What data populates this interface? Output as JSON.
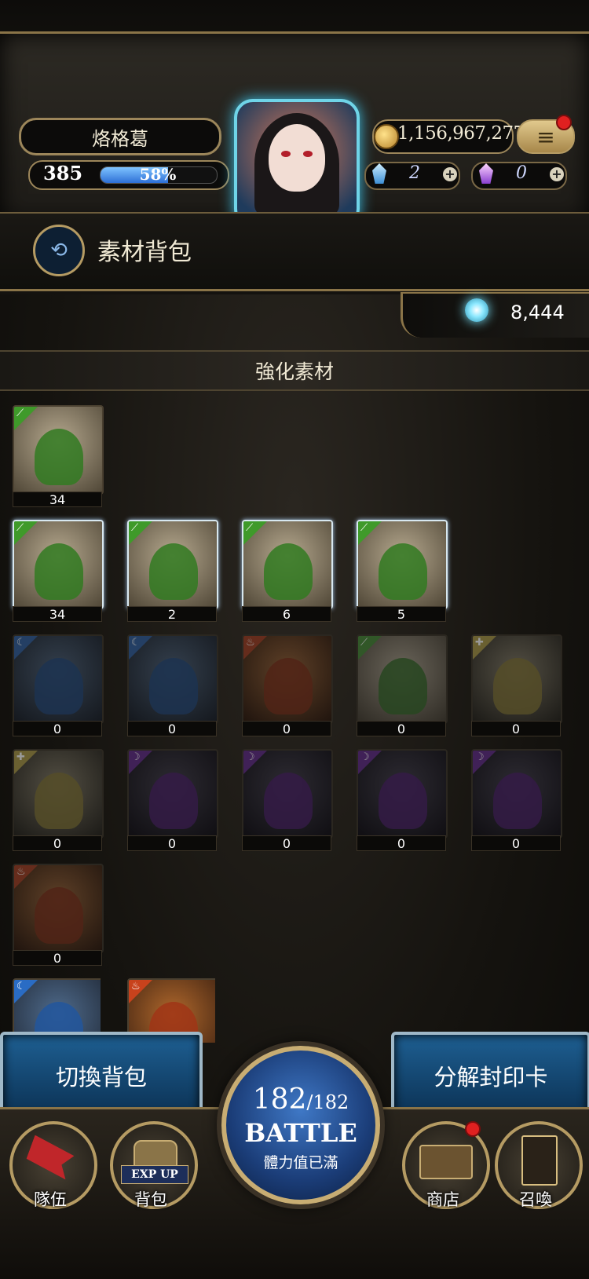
{
  "player": {
    "name": "烙格葛",
    "level": "385",
    "exp_percent": "58%",
    "exp_fraction": 0.58
  },
  "currency": {
    "gold": "1,156,967,277",
    "gems_blue": "2",
    "gems_purple": "0"
  },
  "header": {
    "title": "素材背包"
  },
  "crystals": "8,444",
  "section": {
    "title": "強化素材"
  },
  "materials": [
    {
      "count": "34",
      "element": "wind"
    },
    {
      "count": "34",
      "element": "wind"
    },
    {
      "count": "2",
      "element": "wind"
    },
    {
      "count": "6",
      "element": "wind"
    },
    {
      "count": "5",
      "element": "wind"
    },
    {
      "count": "0",
      "element": "water"
    },
    {
      "count": "0",
      "element": "water"
    },
    {
      "count": "0",
      "element": "fire"
    },
    {
      "count": "0",
      "element": "wind"
    },
    {
      "count": "0",
      "element": "light"
    },
    {
      "count": "0",
      "element": "light"
    },
    {
      "count": "0",
      "element": "dark"
    },
    {
      "count": "0",
      "element": "dark"
    },
    {
      "count": "0",
      "element": "dark"
    },
    {
      "count": "0",
      "element": "dark"
    },
    {
      "count": "0",
      "element": "fire"
    },
    {
      "count": "",
      "element": "water"
    },
    {
      "count": "",
      "element": "fire"
    }
  ],
  "buttons": {
    "switch_bag": "切換背包",
    "decompose": "分解封印卡"
  },
  "battle": {
    "current": "182",
    "max": "/182",
    "label": "BATTLE",
    "status": "體力值已滿"
  },
  "nav": {
    "team": "隊伍",
    "bag": "背包",
    "bag_badge": "EXP UP",
    "shop": "商店",
    "summon": "召喚"
  },
  "colors": {
    "wind": "#3f9a2a",
    "water": "#2a6cc4",
    "fire": "#c8421c",
    "light": "#b8a132",
    "dark": "#7a2fb0"
  }
}
